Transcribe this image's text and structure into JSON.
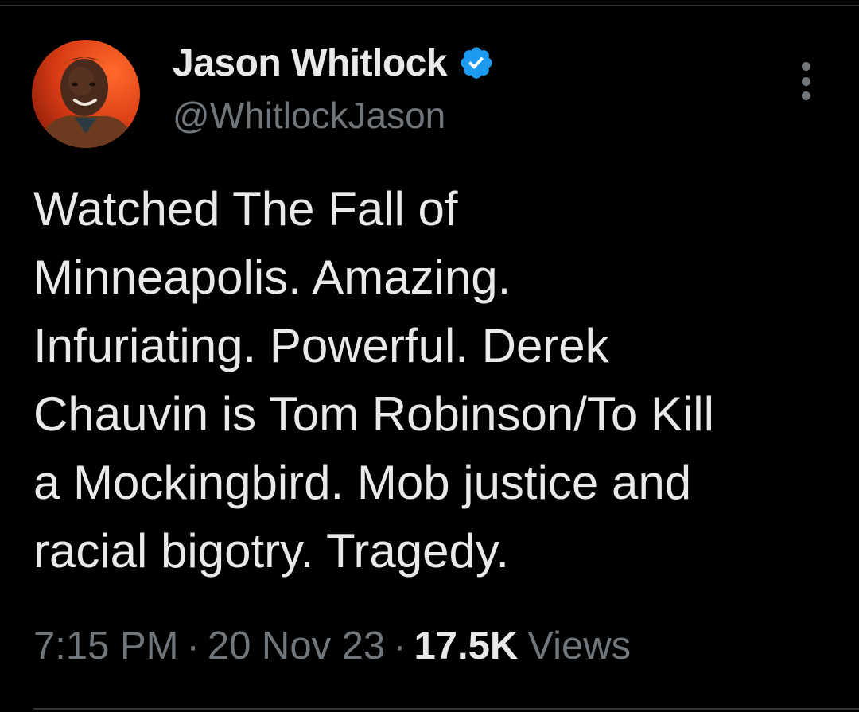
{
  "author": {
    "display_name": "Jason Whitlock",
    "handle": "@WhitlockJason",
    "verified": true,
    "avatar_icon": "profile-photo"
  },
  "tweet": {
    "text": "Watched The Fall of\nMinneapolis. Amazing.\nInfuriating. Powerful. Derek\nChauvin is Tom Robinson/To Kill\na Mockingbird. Mob justice and\nracial bigotry. Tragedy."
  },
  "meta": {
    "time": "7:15 PM",
    "separator": "·",
    "date": "20 Nov 23",
    "views_count": "17.5K",
    "views_label": "Views"
  },
  "menu": {
    "icon": "more-vertical-icon"
  },
  "colors": {
    "background": "#000000",
    "primary_text": "#e7e9ea",
    "secondary_text": "#71767b",
    "verified_badge": "#1d9bf0",
    "divider": "#2f3336"
  }
}
